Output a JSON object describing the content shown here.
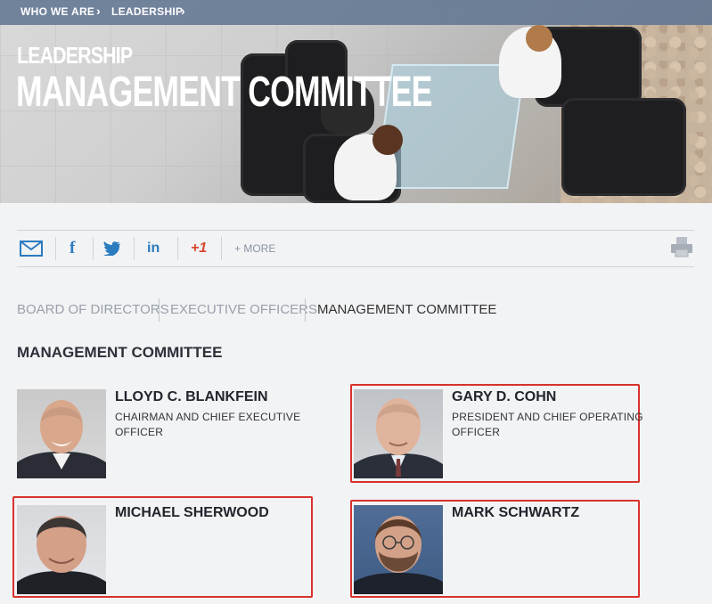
{
  "breadcrumb": {
    "items": [
      "WHO WE ARE",
      "LEADERSHIP"
    ]
  },
  "hero": {
    "subtitle": "LEADERSHIP",
    "title": "MANAGEMENT COMMITTEE"
  },
  "share": {
    "more_label": "+ MORE",
    "google_label": "+1",
    "icons": [
      "email-icon",
      "facebook-icon",
      "twitter-icon",
      "linkedin-icon",
      "google-plus-icon",
      "print-icon"
    ]
  },
  "tabs": [
    {
      "label": "BOARD OF DIRECTORS",
      "active": false
    },
    {
      "label": "EXECUTIVE OFFICERS",
      "active": false
    },
    {
      "label": "MANAGEMENT COMMITTEE",
      "active": true
    }
  ],
  "section_title": "MANAGEMENT COMMITTEE",
  "people": [
    {
      "name": "LLOYD C. BLANKFEIN",
      "role": "CHAIRMAN AND CHIEF EXECUTIVE OFFICER"
    },
    {
      "name": "GARY D. COHN",
      "role": "PRESIDENT AND CHIEF OPERATING OFFICER"
    },
    {
      "name": "MICHAEL SHERWOOD",
      "role": ""
    },
    {
      "name": "MARK SCHWARTZ",
      "role": ""
    }
  ],
  "colors": {
    "highlight": "#d9322b",
    "breadcrumb_bg": "#5f7391",
    "share_blue": "#2b7bbf",
    "google_red": "#d6492f"
  }
}
